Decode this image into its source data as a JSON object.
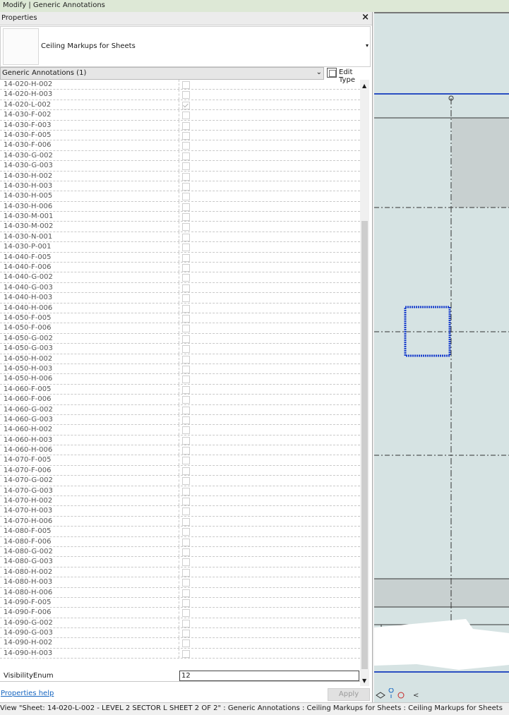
{
  "window": {
    "title": "Modify | Generic Annotations"
  },
  "palette": {
    "title": "Properties",
    "close_glyph": "×",
    "type_name": "Ceiling Markups for Sheets",
    "dropdown_glyph": "▾",
    "filter_label": "Generic Annotations (1)",
    "filter_glyph": "⌄",
    "edit_type_label": "Edit Type",
    "rows": [
      {
        "name": "14-020-H-002",
        "checked": false
      },
      {
        "name": "14-020-H-003",
        "checked": false
      },
      {
        "name": "14-020-L-002",
        "checked": true
      },
      {
        "name": "14-030-F-002",
        "checked": false
      },
      {
        "name": "14-030-F-003",
        "checked": false
      },
      {
        "name": "14-030-F-005",
        "checked": false
      },
      {
        "name": "14-030-F-006",
        "checked": false
      },
      {
        "name": "14-030-G-002",
        "checked": false
      },
      {
        "name": "14-030-G-003",
        "checked": false
      },
      {
        "name": "14-030-H-002",
        "checked": false
      },
      {
        "name": "14-030-H-003",
        "checked": false
      },
      {
        "name": "14-030-H-005",
        "checked": false
      },
      {
        "name": "14-030-H-006",
        "checked": false
      },
      {
        "name": "14-030-M-001",
        "checked": false
      },
      {
        "name": "14-030-M-002",
        "checked": false
      },
      {
        "name": "14-030-N-001",
        "checked": false
      },
      {
        "name": "14-030-P-001",
        "checked": false
      },
      {
        "name": "14-040-F-005",
        "checked": false
      },
      {
        "name": "14-040-F-006",
        "checked": false
      },
      {
        "name": "14-040-G-002",
        "checked": false
      },
      {
        "name": "14-040-G-003",
        "checked": false
      },
      {
        "name": "14-040-H-003",
        "checked": false
      },
      {
        "name": "14-040-H-006",
        "checked": false
      },
      {
        "name": "14-050-F-005",
        "checked": false
      },
      {
        "name": "14-050-F-006",
        "checked": false
      },
      {
        "name": "14-050-G-002",
        "checked": false
      },
      {
        "name": "14-050-G-003",
        "checked": false
      },
      {
        "name": "14-050-H-002",
        "checked": false
      },
      {
        "name": "14-050-H-003",
        "checked": false
      },
      {
        "name": "14-050-H-006",
        "checked": false
      },
      {
        "name": "14-060-F-005",
        "checked": false
      },
      {
        "name": "14-060-F-006",
        "checked": false
      },
      {
        "name": "14-060-G-002",
        "checked": false
      },
      {
        "name": "14-060-G-003",
        "checked": false
      },
      {
        "name": "14-060-H-002",
        "checked": false
      },
      {
        "name": "14-060-H-003",
        "checked": false
      },
      {
        "name": "14-060-H-006",
        "checked": false
      },
      {
        "name": "14-070-F-005",
        "checked": false
      },
      {
        "name": "14-070-F-006",
        "checked": false
      },
      {
        "name": "14-070-G-002",
        "checked": false
      },
      {
        "name": "14-070-G-003",
        "checked": false
      },
      {
        "name": "14-070-H-002",
        "checked": false
      },
      {
        "name": "14-070-H-003",
        "checked": false
      },
      {
        "name": "14-070-H-006",
        "checked": false
      },
      {
        "name": "14-080-F-005",
        "checked": false
      },
      {
        "name": "14-080-F-006",
        "checked": false
      },
      {
        "name": "14-080-G-002",
        "checked": false
      },
      {
        "name": "14-080-G-003",
        "checked": false
      },
      {
        "name": "14-080-H-002",
        "checked": false
      },
      {
        "name": "14-080-H-003",
        "checked": false
      },
      {
        "name": "14-080-H-006",
        "checked": false
      },
      {
        "name": "14-090-F-005",
        "checked": false
      },
      {
        "name": "14-090-F-006",
        "checked": false
      },
      {
        "name": "14-090-G-002",
        "checked": false
      },
      {
        "name": "14-090-G-003",
        "checked": false
      },
      {
        "name": "14-090-H-002",
        "checked": false
      },
      {
        "name": "14-090-H-003",
        "checked": false
      }
    ],
    "visibility": {
      "name": "VisibilityEnum",
      "value": "12"
    },
    "scroll_up_glyph": "▲",
    "scroll_down_glyph": "▼",
    "help_link": "Properties help",
    "apply_label": "Apply"
  },
  "canvas": {
    "nav_glyph": "<"
  },
  "status": {
    "left": "View \"Sheet: 14-020-L-002 - LEVEL 2 SECTOR L",
    "right": "SHEET 2 OF 2\" : Generic Annotations : Ceiling Markups for Sheets : Ceiling Markups for Sheets"
  },
  "colors": {
    "canvas_bg": "#d6e3e3",
    "selection_blue": "#1a3fcc",
    "grid_blue": "#2b4fc2",
    "link_blue": "#1565c0"
  }
}
